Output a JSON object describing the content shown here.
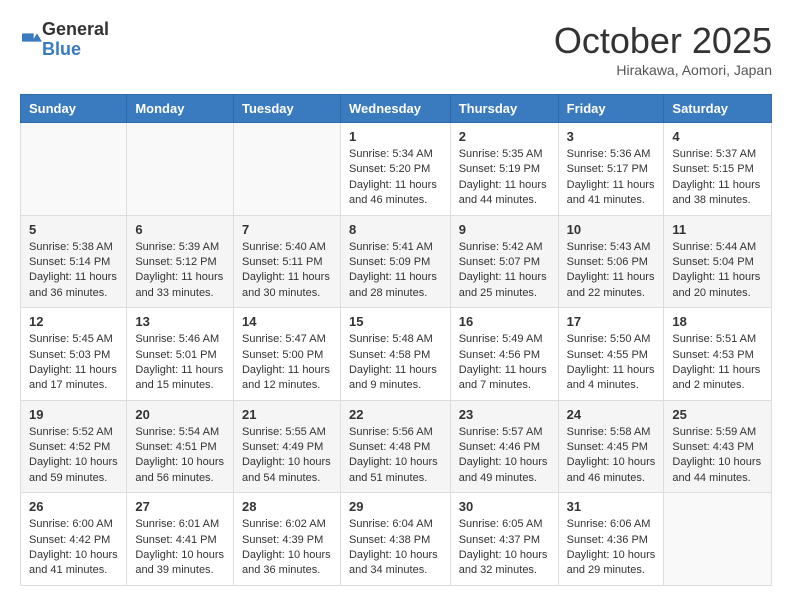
{
  "header": {
    "logo_general": "General",
    "logo_blue": "Blue",
    "month": "October 2025",
    "location": "Hirakawa, Aomori, Japan"
  },
  "days_of_week": [
    "Sunday",
    "Monday",
    "Tuesday",
    "Wednesday",
    "Thursday",
    "Friday",
    "Saturday"
  ],
  "weeks": [
    [
      {
        "day": "",
        "info": ""
      },
      {
        "day": "",
        "info": ""
      },
      {
        "day": "",
        "info": ""
      },
      {
        "day": "1",
        "info": "Sunrise: 5:34 AM\nSunset: 5:20 PM\nDaylight: 11 hours\nand 46 minutes."
      },
      {
        "day": "2",
        "info": "Sunrise: 5:35 AM\nSunset: 5:19 PM\nDaylight: 11 hours\nand 44 minutes."
      },
      {
        "day": "3",
        "info": "Sunrise: 5:36 AM\nSunset: 5:17 PM\nDaylight: 11 hours\nand 41 minutes."
      },
      {
        "day": "4",
        "info": "Sunrise: 5:37 AM\nSunset: 5:15 PM\nDaylight: 11 hours\nand 38 minutes."
      }
    ],
    [
      {
        "day": "5",
        "info": "Sunrise: 5:38 AM\nSunset: 5:14 PM\nDaylight: 11 hours\nand 36 minutes."
      },
      {
        "day": "6",
        "info": "Sunrise: 5:39 AM\nSunset: 5:12 PM\nDaylight: 11 hours\nand 33 minutes."
      },
      {
        "day": "7",
        "info": "Sunrise: 5:40 AM\nSunset: 5:11 PM\nDaylight: 11 hours\nand 30 minutes."
      },
      {
        "day": "8",
        "info": "Sunrise: 5:41 AM\nSunset: 5:09 PM\nDaylight: 11 hours\nand 28 minutes."
      },
      {
        "day": "9",
        "info": "Sunrise: 5:42 AM\nSunset: 5:07 PM\nDaylight: 11 hours\nand 25 minutes."
      },
      {
        "day": "10",
        "info": "Sunrise: 5:43 AM\nSunset: 5:06 PM\nDaylight: 11 hours\nand 22 minutes."
      },
      {
        "day": "11",
        "info": "Sunrise: 5:44 AM\nSunset: 5:04 PM\nDaylight: 11 hours\nand 20 minutes."
      }
    ],
    [
      {
        "day": "12",
        "info": "Sunrise: 5:45 AM\nSunset: 5:03 PM\nDaylight: 11 hours\nand 17 minutes."
      },
      {
        "day": "13",
        "info": "Sunrise: 5:46 AM\nSunset: 5:01 PM\nDaylight: 11 hours\nand 15 minutes."
      },
      {
        "day": "14",
        "info": "Sunrise: 5:47 AM\nSunset: 5:00 PM\nDaylight: 11 hours\nand 12 minutes."
      },
      {
        "day": "15",
        "info": "Sunrise: 5:48 AM\nSunset: 4:58 PM\nDaylight: 11 hours\nand 9 minutes."
      },
      {
        "day": "16",
        "info": "Sunrise: 5:49 AM\nSunset: 4:56 PM\nDaylight: 11 hours\nand 7 minutes."
      },
      {
        "day": "17",
        "info": "Sunrise: 5:50 AM\nSunset: 4:55 PM\nDaylight: 11 hours\nand 4 minutes."
      },
      {
        "day": "18",
        "info": "Sunrise: 5:51 AM\nSunset: 4:53 PM\nDaylight: 11 hours\nand 2 minutes."
      }
    ],
    [
      {
        "day": "19",
        "info": "Sunrise: 5:52 AM\nSunset: 4:52 PM\nDaylight: 10 hours\nand 59 minutes."
      },
      {
        "day": "20",
        "info": "Sunrise: 5:54 AM\nSunset: 4:51 PM\nDaylight: 10 hours\nand 56 minutes."
      },
      {
        "day": "21",
        "info": "Sunrise: 5:55 AM\nSunset: 4:49 PM\nDaylight: 10 hours\nand 54 minutes."
      },
      {
        "day": "22",
        "info": "Sunrise: 5:56 AM\nSunset: 4:48 PM\nDaylight: 10 hours\nand 51 minutes."
      },
      {
        "day": "23",
        "info": "Sunrise: 5:57 AM\nSunset: 4:46 PM\nDaylight: 10 hours\nand 49 minutes."
      },
      {
        "day": "24",
        "info": "Sunrise: 5:58 AM\nSunset: 4:45 PM\nDaylight: 10 hours\nand 46 minutes."
      },
      {
        "day": "25",
        "info": "Sunrise: 5:59 AM\nSunset: 4:43 PM\nDaylight: 10 hours\nand 44 minutes."
      }
    ],
    [
      {
        "day": "26",
        "info": "Sunrise: 6:00 AM\nSunset: 4:42 PM\nDaylight: 10 hours\nand 41 minutes."
      },
      {
        "day": "27",
        "info": "Sunrise: 6:01 AM\nSunset: 4:41 PM\nDaylight: 10 hours\nand 39 minutes."
      },
      {
        "day": "28",
        "info": "Sunrise: 6:02 AM\nSunset: 4:39 PM\nDaylight: 10 hours\nand 36 minutes."
      },
      {
        "day": "29",
        "info": "Sunrise: 6:04 AM\nSunset: 4:38 PM\nDaylight: 10 hours\nand 34 minutes."
      },
      {
        "day": "30",
        "info": "Sunrise: 6:05 AM\nSunset: 4:37 PM\nDaylight: 10 hours\nand 32 minutes."
      },
      {
        "day": "31",
        "info": "Sunrise: 6:06 AM\nSunset: 4:36 PM\nDaylight: 10 hours\nand 29 minutes."
      },
      {
        "day": "",
        "info": ""
      }
    ]
  ]
}
